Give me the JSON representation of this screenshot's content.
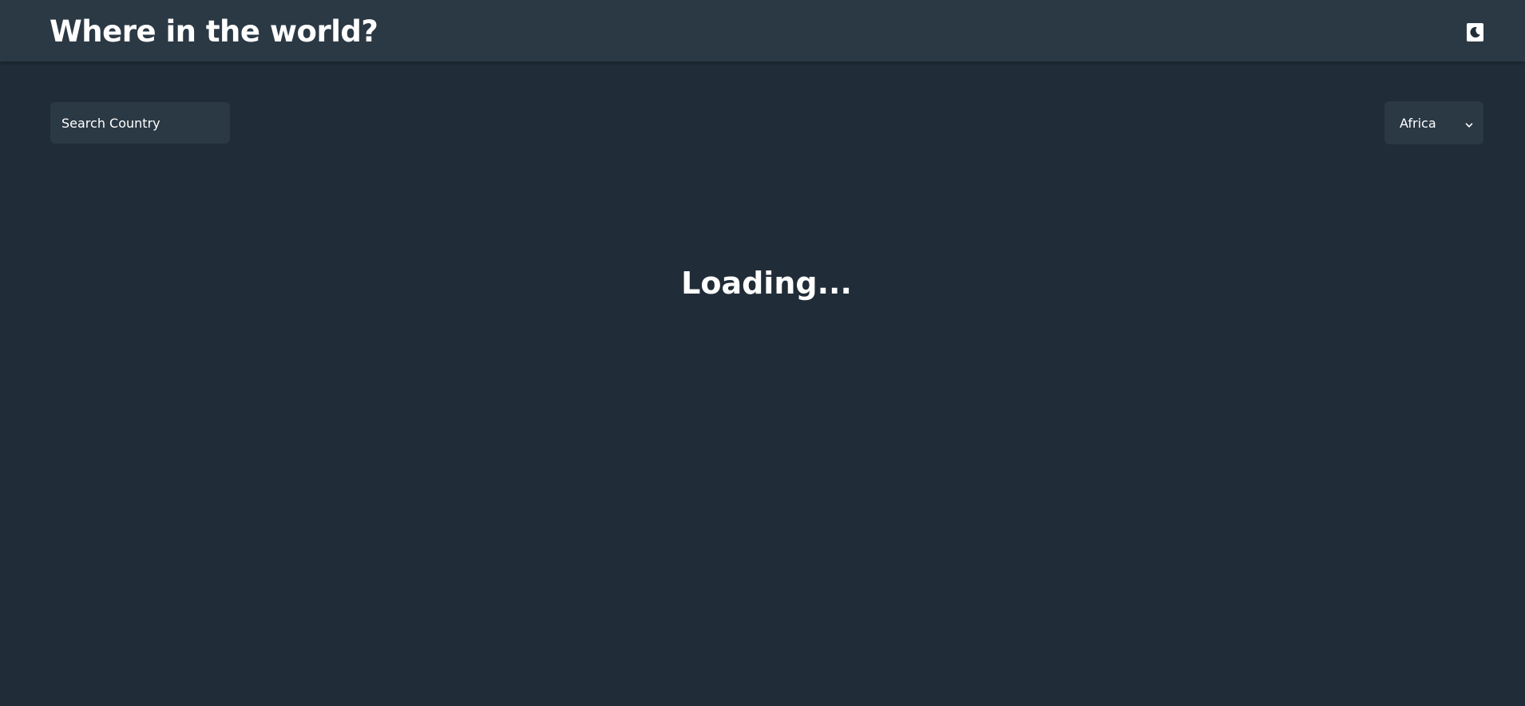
{
  "header": {
    "title": "Where in the world?",
    "theme_toggle_icon": "moon-icon"
  },
  "search": {
    "placeholder": "Search Country",
    "value": ""
  },
  "filter": {
    "selected_region": "Africa",
    "icon": "chevron-down-icon"
  },
  "status": {
    "loading_text": "Loading..."
  },
  "colors": {
    "background": "#202c37",
    "surface": "#2b3945",
    "text": "#ffffff"
  }
}
